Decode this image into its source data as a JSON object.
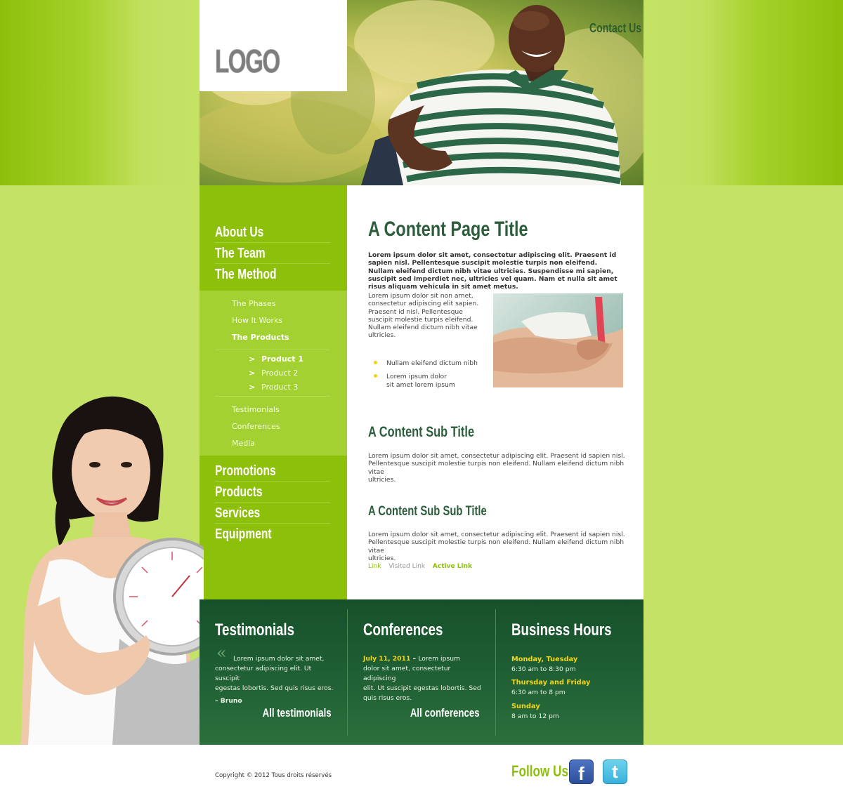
{
  "header": {
    "logo": "LOGO",
    "contact_label": "Contact Us"
  },
  "nav": {
    "main_items": [
      "About Us",
      "The Team",
      "The Method"
    ],
    "sub_items": [
      "The Phases",
      "How It Works",
      "The Products"
    ],
    "active_sub": "The Products",
    "products": [
      "Product 1",
      "Product 2",
      "Product 3"
    ],
    "product_arrow": ">",
    "sub_items_2": [
      "Testimonials",
      "Conferences",
      "Media"
    ],
    "bottom_items": [
      "Promotions",
      "Products",
      "Services",
      "Equipment"
    ]
  },
  "content": {
    "title": "A Content Page Title",
    "intro": "Lorem ipsum dolor sit amet, consectetur adipiscing elit. Praesent id sapien nisl. Pellentesque suscipit molestie turpis non eleifend. Nullam eleifend dictum nibh vitae ultricies. Suspendisse mi sapien, suscipit sed imperdiet nec, ultricies vel quam. Nam et nulla sit amet risus aliquam vehicula in sit amet metus.",
    "side_text_lines": [
      "Lorem ipsum dolor sit non amet,",
      "consectetur adipiscing elit sapien.",
      "Praesent id nisl. Pellentesque",
      "suscipit molestie turpis eleifend.",
      "Nullam eleifend dictum nibh vitae",
      "ultricies."
    ],
    "bullets": [
      [
        "Nullam eleifend dictum nibh"
      ],
      [
        "Lorem ipsum dolor",
        "sit amet lorem ipsum"
      ]
    ],
    "sub_title": "A Content Sub Title",
    "sub_text_lines": [
      "Lorem ipsum dolor sit amet, consectetur adipiscing elit. Praesent id sapien nisl.",
      "Pellentesque suscipit molestie turpis non eleifend. Nullam eleifend dictum nibh vitae",
      "ultricies."
    ],
    "sub_sub_title": "A Content Sub Sub Title",
    "sub_sub_text_lines": [
      "Lorem ipsum dolor sit amet, consectetur adipiscing elit. Praesent id sapien nisl.",
      "Pellentesque suscipit molestie turpis non eleifend. Nullam eleifend dictum nibh vitae",
      "ultricies."
    ],
    "link": "Link",
    "visited_link": "Visited Link",
    "active_link": "Active Link"
  },
  "footer_cols": {
    "testimonials": {
      "title": "Testimonials",
      "text_lines": [
        "Lorem ipsum dolor sit amet,",
        "consectetur adipiscing elit. Ut suscipit",
        "egestas lobortis. Sed quis risus eros."
      ],
      "author": "– Bruno",
      "link": "All testimonials",
      "quote_mark": "«"
    },
    "conferences": {
      "title": "Conferences",
      "date": "July 11, 2011",
      "dash": " – ",
      "first_line": "Lorem ipsum",
      "text_lines": [
        "dolor sit amet, consectetur adipiscing",
        "elit. Ut suscipit egestas lobortis. Sed",
        "quis risus eros."
      ],
      "link": "All conferences"
    },
    "hours": {
      "title": "Business Hours",
      "rows": [
        {
          "day": "Monday, Tuesday",
          "time": "6:30 am to 8:30 pm"
        },
        {
          "day": "Thursday and Friday",
          "time": "6:30 am to 8 pm"
        },
        {
          "day": "Sunday",
          "time": "8 am to 12 pm"
        }
      ]
    }
  },
  "page_footer": {
    "copyright": "Copyright © 2012 Tous droits réservés",
    "follow": "Follow Us!",
    "facebook_icon": "f",
    "twitter_icon": "t"
  },
  "colors": {
    "lime": "#8dc00a",
    "light_lime": "#c4e265",
    "dark_green": "#1f5f34",
    "title_green": "#2c5e3c",
    "yellow": "#f3d51a"
  }
}
